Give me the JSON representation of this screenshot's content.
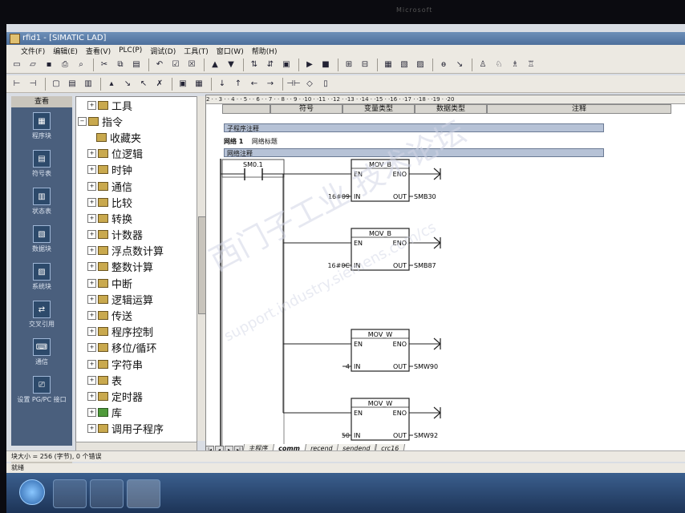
{
  "window": {
    "title": "rfid1 - [SIMATIC LAD]",
    "brand": "Microsoft"
  },
  "menu": [
    "文件(F)",
    "编辑(E)",
    "查看(V)",
    "PLC(P)",
    "调试(D)",
    "工具(T)",
    "窗口(W)",
    "帮助(H)"
  ],
  "nav": {
    "header": "查看",
    "items": [
      "程序块",
      "符号表",
      "状态表",
      "数据块",
      "系统块",
      "交叉引用",
      "通信",
      "设置 PG/PC 接口"
    ],
    "footer": "工具"
  },
  "tree": {
    "top": "工具",
    "root": "指令",
    "items": [
      "收藏夹",
      "位逻辑",
      "时钟",
      "通信",
      "比较",
      "转换",
      "计数器",
      "浮点数计算",
      "整数计算",
      "中断",
      "逻辑运算",
      "传送",
      "程序控制",
      "移位/循环",
      "字符串",
      "表",
      "定时器",
      "库",
      "调用子程序"
    ]
  },
  "ruler": "2 · · 3 · · 4 · · 5 · · 6 · · 7 · · 8 · · 9 · ·10 · ·11 · ·12 · ·13 · ·14 · ·15 · ·16 · ·17 · ·18 · ·19 · ·20",
  "var_table": {
    "headers": [
      "符号",
      "变量类型",
      "数据类型",
      "注释"
    ]
  },
  "editor": {
    "sub_comment": "子程序注释",
    "network_label": "网络 1",
    "network_title": "网络标题",
    "network_comment": "网络注释",
    "contact": "SM0.1",
    "blocks": [
      {
        "name": "MOV_B",
        "en": "EN",
        "eno": "ENO",
        "in_label": "IN",
        "out_label": "OUT",
        "in": "16#09",
        "out": "SMB30"
      },
      {
        "name": "MOV_B",
        "en": "EN",
        "eno": "ENO",
        "in_label": "IN",
        "out_label": "OUT",
        "in": "16#0C",
        "out": "SMB87"
      },
      {
        "name": "MOV_W",
        "en": "EN",
        "eno": "ENO",
        "in_label": "IN",
        "out_label": "OUT",
        "in": "4",
        "out": "SMW90"
      },
      {
        "name": "MOV_W",
        "en": "EN",
        "eno": "ENO",
        "in_label": "IN",
        "out_label": "OUT",
        "in": "50",
        "out": "SMW92"
      }
    ]
  },
  "tabs": [
    "主程序",
    "comm",
    "recend",
    "sendend",
    "crc16"
  ],
  "active_tab": "comm",
  "status": {
    "line1": "块大小 = 256 (字节), 0 个错误",
    "line2": "就绪"
  },
  "watermark": {
    "line1": "西门子工业 技术论坛",
    "line2": "support.industry.siemens.com/cs"
  },
  "colors": {
    "titlebar": "#5b7da8",
    "network_bar": "#b6c2d6",
    "nav_panel": "#4a5f7d"
  }
}
